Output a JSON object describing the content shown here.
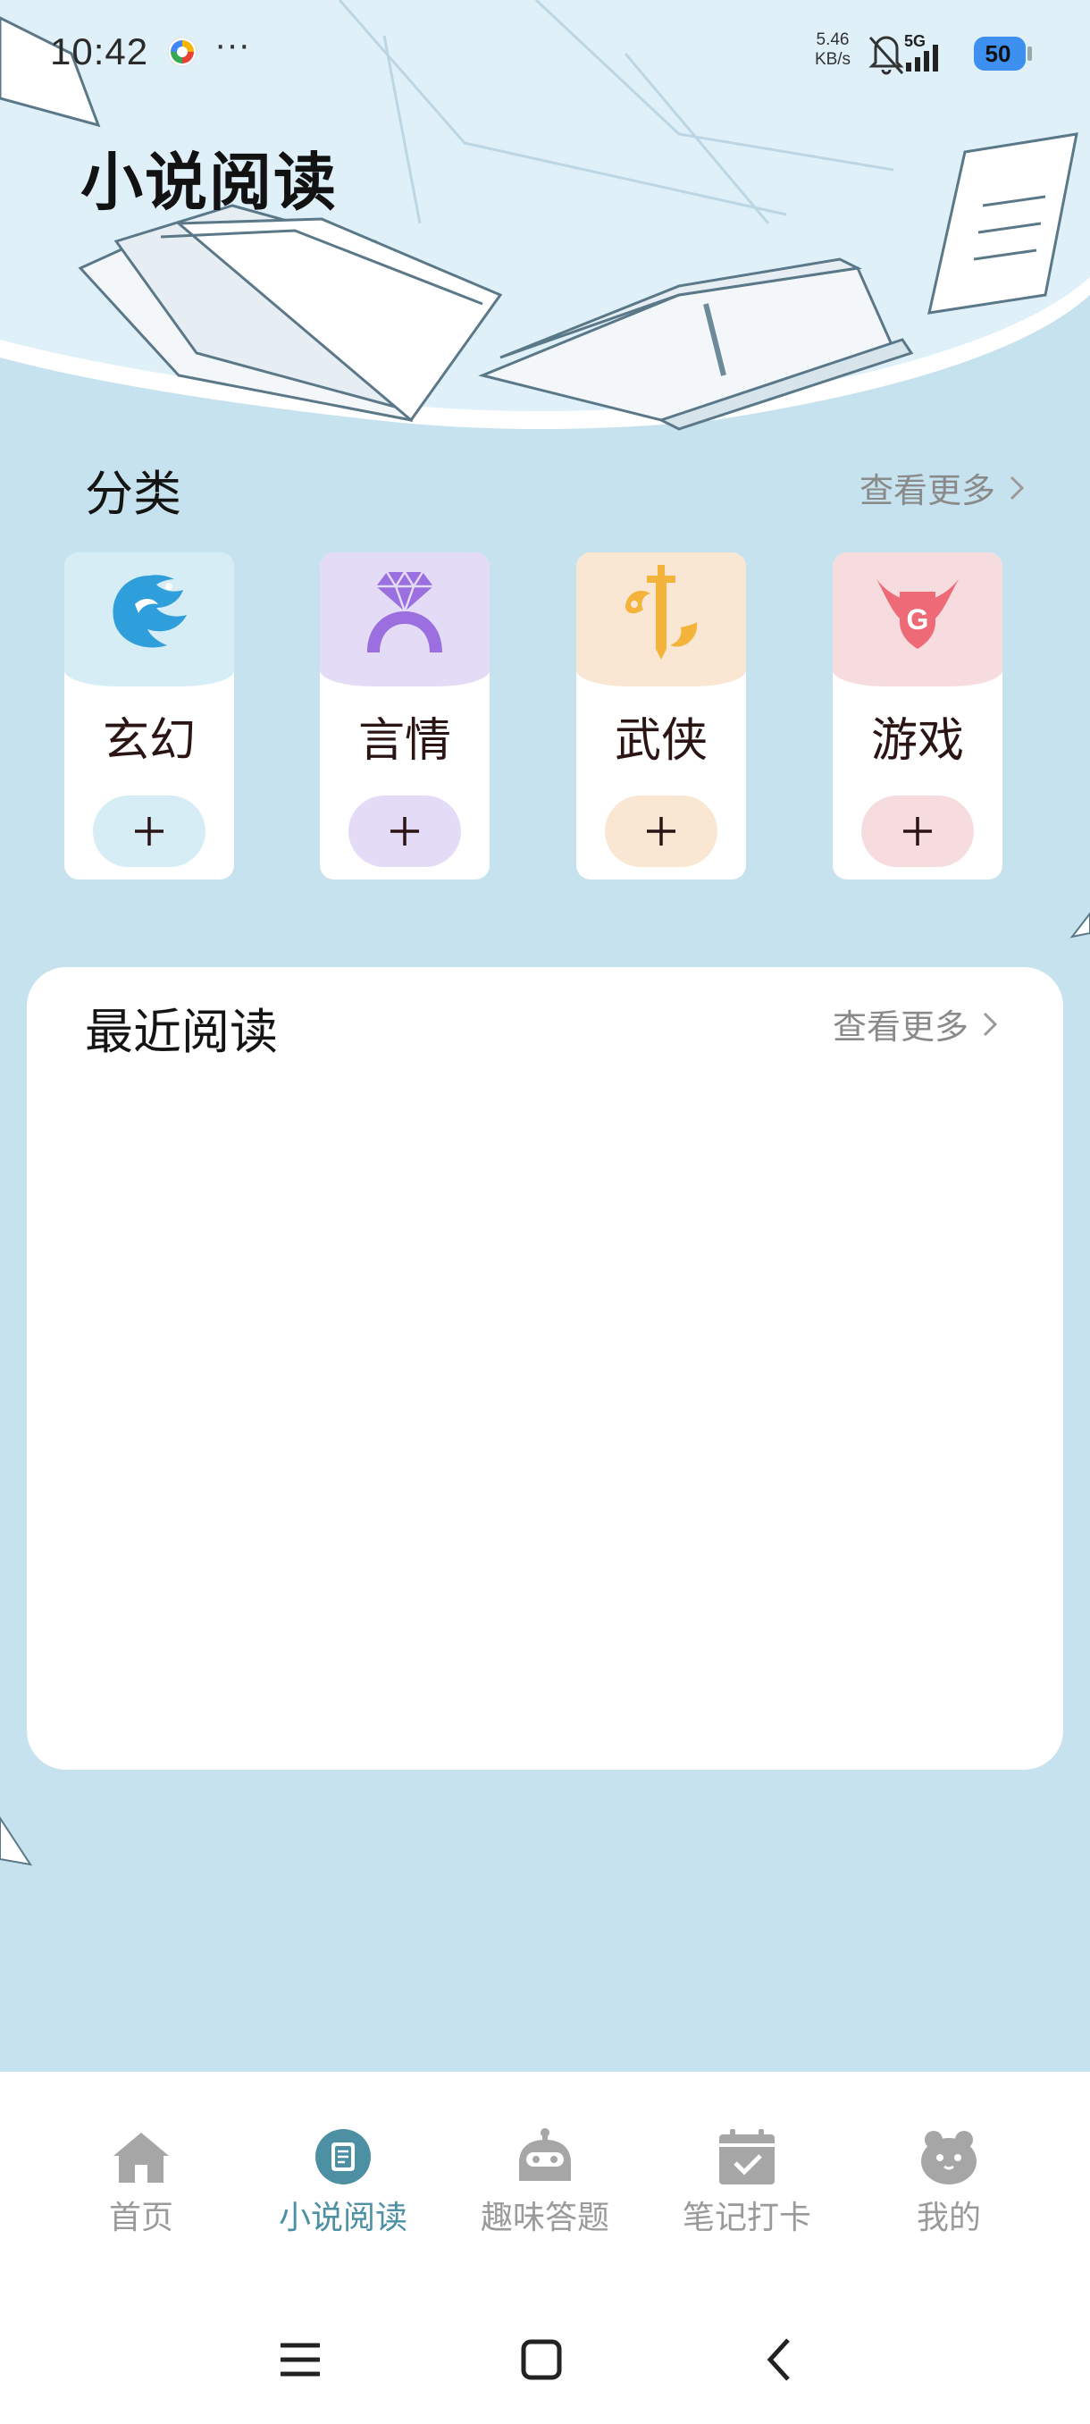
{
  "status_bar": {
    "time": "10:42",
    "more": "···",
    "net_speed_value": "5.46",
    "net_speed_unit": "KB/s",
    "signal_type": "5G",
    "battery": "50"
  },
  "page": {
    "title": "小说阅读"
  },
  "categories_section": {
    "title": "分类",
    "more_label": "查看更多",
    "items": [
      {
        "label": "玄幻",
        "icon": "phoenix-icon",
        "tint": "#d6edf6",
        "add_tint": "#d6edf6",
        "accent": "#2f9fdb"
      },
      {
        "label": "言情",
        "icon": "diamond-ring-icon",
        "tint": "#e4dcf6",
        "add_tint": "#e4dcf6",
        "accent": "#9b6fe0"
      },
      {
        "label": "武侠",
        "icon": "sword-icon",
        "tint": "#f9e7d3",
        "add_tint": "#f9e7d3",
        "accent": "#f4b43b"
      },
      {
        "label": "游戏",
        "icon": "game-shield-icon",
        "tint": "#f6dcdf",
        "add_tint": "#f6dcdf",
        "accent": "#ef6a77"
      }
    ]
  },
  "recent_section": {
    "title": "最近阅读",
    "more_label": "查看更多"
  },
  "bottom_nav": {
    "items": [
      {
        "label": "首页",
        "icon": "home-icon",
        "active": false
      },
      {
        "label": "小说阅读",
        "icon": "book-icon",
        "active": true
      },
      {
        "label": "趣味答题",
        "icon": "robot-icon",
        "active": false
      },
      {
        "label": "笔记打卡",
        "icon": "calendar-check-icon",
        "active": false
      },
      {
        "label": "我的",
        "icon": "mascot-icon",
        "active": false
      }
    ]
  },
  "colors": {
    "background": "#c6e2ee",
    "active_nav": "#4d8fa3",
    "inactive_nav": "#9a9a9a"
  }
}
